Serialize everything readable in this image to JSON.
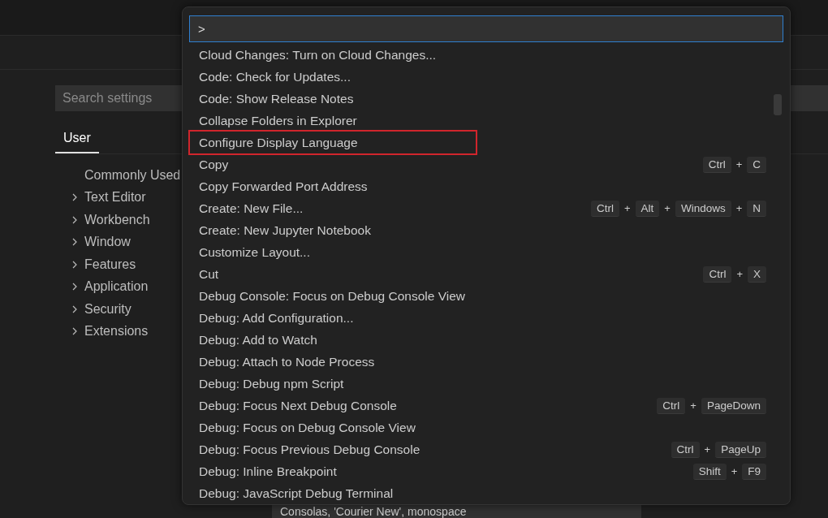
{
  "settings": {
    "search": {
      "placeholder": "Search settings"
    },
    "tabs": [
      {
        "label": "User",
        "selected": true
      }
    ],
    "tree": [
      {
        "label": "Commonly Used",
        "expandable": false
      },
      {
        "label": "Text Editor",
        "expandable": true
      },
      {
        "label": "Workbench",
        "expandable": true
      },
      {
        "label": "Window",
        "expandable": true
      },
      {
        "label": "Features",
        "expandable": true
      },
      {
        "label": "Application",
        "expandable": true
      },
      {
        "label": "Security",
        "expandable": true
      },
      {
        "label": "Extensions",
        "expandable": true
      }
    ],
    "font_family_field": {
      "value": "Consolas, 'Courier New', monospace"
    }
  },
  "command_palette": {
    "input": {
      "value": ">"
    },
    "items": [
      {
        "label": "Cloud Changes: Turn on Cloud Changes...",
        "highlighted": false
      },
      {
        "label": "Code: Check for Updates...",
        "highlighted": false
      },
      {
        "label": "Code: Show Release Notes",
        "highlighted": false
      },
      {
        "label": "Collapse Folders in Explorer",
        "highlighted": false
      },
      {
        "label": "Configure Display Language",
        "highlighted": true
      },
      {
        "label": "Copy",
        "highlighted": false,
        "keys": [
          "Ctrl",
          "+",
          "C"
        ]
      },
      {
        "label": "Copy Forwarded Port Address",
        "highlighted": false
      },
      {
        "label": "Create: New File...",
        "highlighted": false,
        "keys": [
          "Ctrl",
          "+",
          "Alt",
          "+",
          "Windows",
          "+",
          "N"
        ]
      },
      {
        "label": "Create: New Jupyter Notebook",
        "highlighted": false
      },
      {
        "label": "Customize Layout...",
        "highlighted": false
      },
      {
        "label": "Cut",
        "highlighted": false,
        "keys": [
          "Ctrl",
          "+",
          "X"
        ]
      },
      {
        "label": "Debug Console: Focus on Debug Console View",
        "highlighted": false
      },
      {
        "label": "Debug: Add Configuration...",
        "highlighted": false
      },
      {
        "label": "Debug: Add to Watch",
        "highlighted": false
      },
      {
        "label": "Debug: Attach to Node Process",
        "highlighted": false
      },
      {
        "label": "Debug: Debug npm Script",
        "highlighted": false
      },
      {
        "label": "Debug: Focus Next Debug Console",
        "highlighted": false,
        "keys": [
          "Ctrl",
          "+",
          "PageDown"
        ]
      },
      {
        "label": "Debug: Focus on Debug Console View",
        "highlighted": false
      },
      {
        "label": "Debug: Focus Previous Debug Console",
        "highlighted": false,
        "keys": [
          "Ctrl",
          "+",
          "PageUp"
        ]
      },
      {
        "label": "Debug: Inline Breakpoint",
        "highlighted": false,
        "keys": [
          "Shift",
          "+",
          "F9"
        ]
      },
      {
        "label": "Debug: JavaScript Debug Terminal",
        "highlighted": false
      }
    ]
  }
}
